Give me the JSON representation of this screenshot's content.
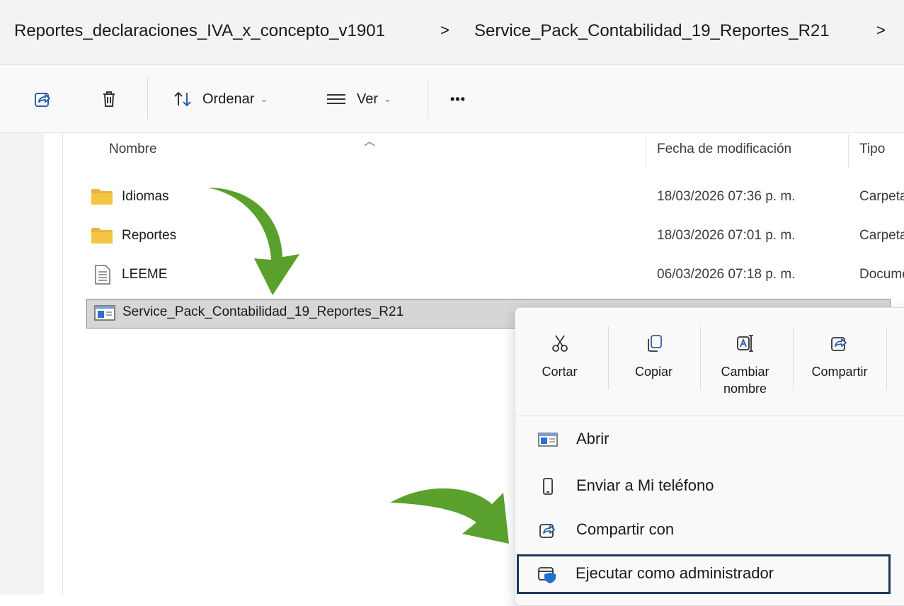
{
  "breadcrumb": {
    "items": [
      "Reportes_declaraciones_IVA_x_concepto_v1901",
      "Service_Pack_Contabilidad_19_Reportes_R21"
    ],
    "separator": ">"
  },
  "toolbar": {
    "sort_label": "Ordenar",
    "view_label": "Ver",
    "more_label": "•••"
  },
  "columns": {
    "name": "Nombre",
    "date": "Fecha de modificación",
    "type": "Tipo"
  },
  "files": [
    {
      "name": "Idiomas",
      "date": "18/03/2026 07:36 p. m.",
      "type": "Carpeta de archivos",
      "icon": "folder-icon"
    },
    {
      "name": "Reportes",
      "date": "18/03/2026 07:01 p. m.",
      "type": "Carpeta de archivos",
      "icon": "folder-icon"
    },
    {
      "name": "LEEME",
      "date": "06/03/2026 07:18 p. m.",
      "type": "Documento de texto",
      "icon": "text-file-icon"
    },
    {
      "name": "Service_Pack_Contabilidad_19_Reportes_R21",
      "date": "",
      "type": "",
      "icon": "application-icon",
      "selected": true
    }
  ],
  "context_menu": {
    "quick_actions": [
      {
        "label": "Cortar",
        "icon": "scissors-icon"
      },
      {
        "label": "Copiar",
        "icon": "copy-icon"
      },
      {
        "label": "Cambiar nombre",
        "icon": "rename-icon"
      },
      {
        "label": "Compartir",
        "icon": "share-icon"
      }
    ],
    "items": [
      {
        "label": "Abrir",
        "icon": "application-icon"
      },
      {
        "label": "Enviar a Mi teléfono",
        "icon": "phone-icon"
      },
      {
        "label": "Compartir con",
        "icon": "share-icon"
      },
      {
        "label": "Ejecutar como administrador",
        "icon": "shield-icon",
        "focused": true
      }
    ]
  },
  "colors": {
    "accent_green": "#5aa02c",
    "focus_border": "#1b3a5c",
    "selection": "#d6d6d6",
    "folder_yellow": "#f4c542"
  }
}
